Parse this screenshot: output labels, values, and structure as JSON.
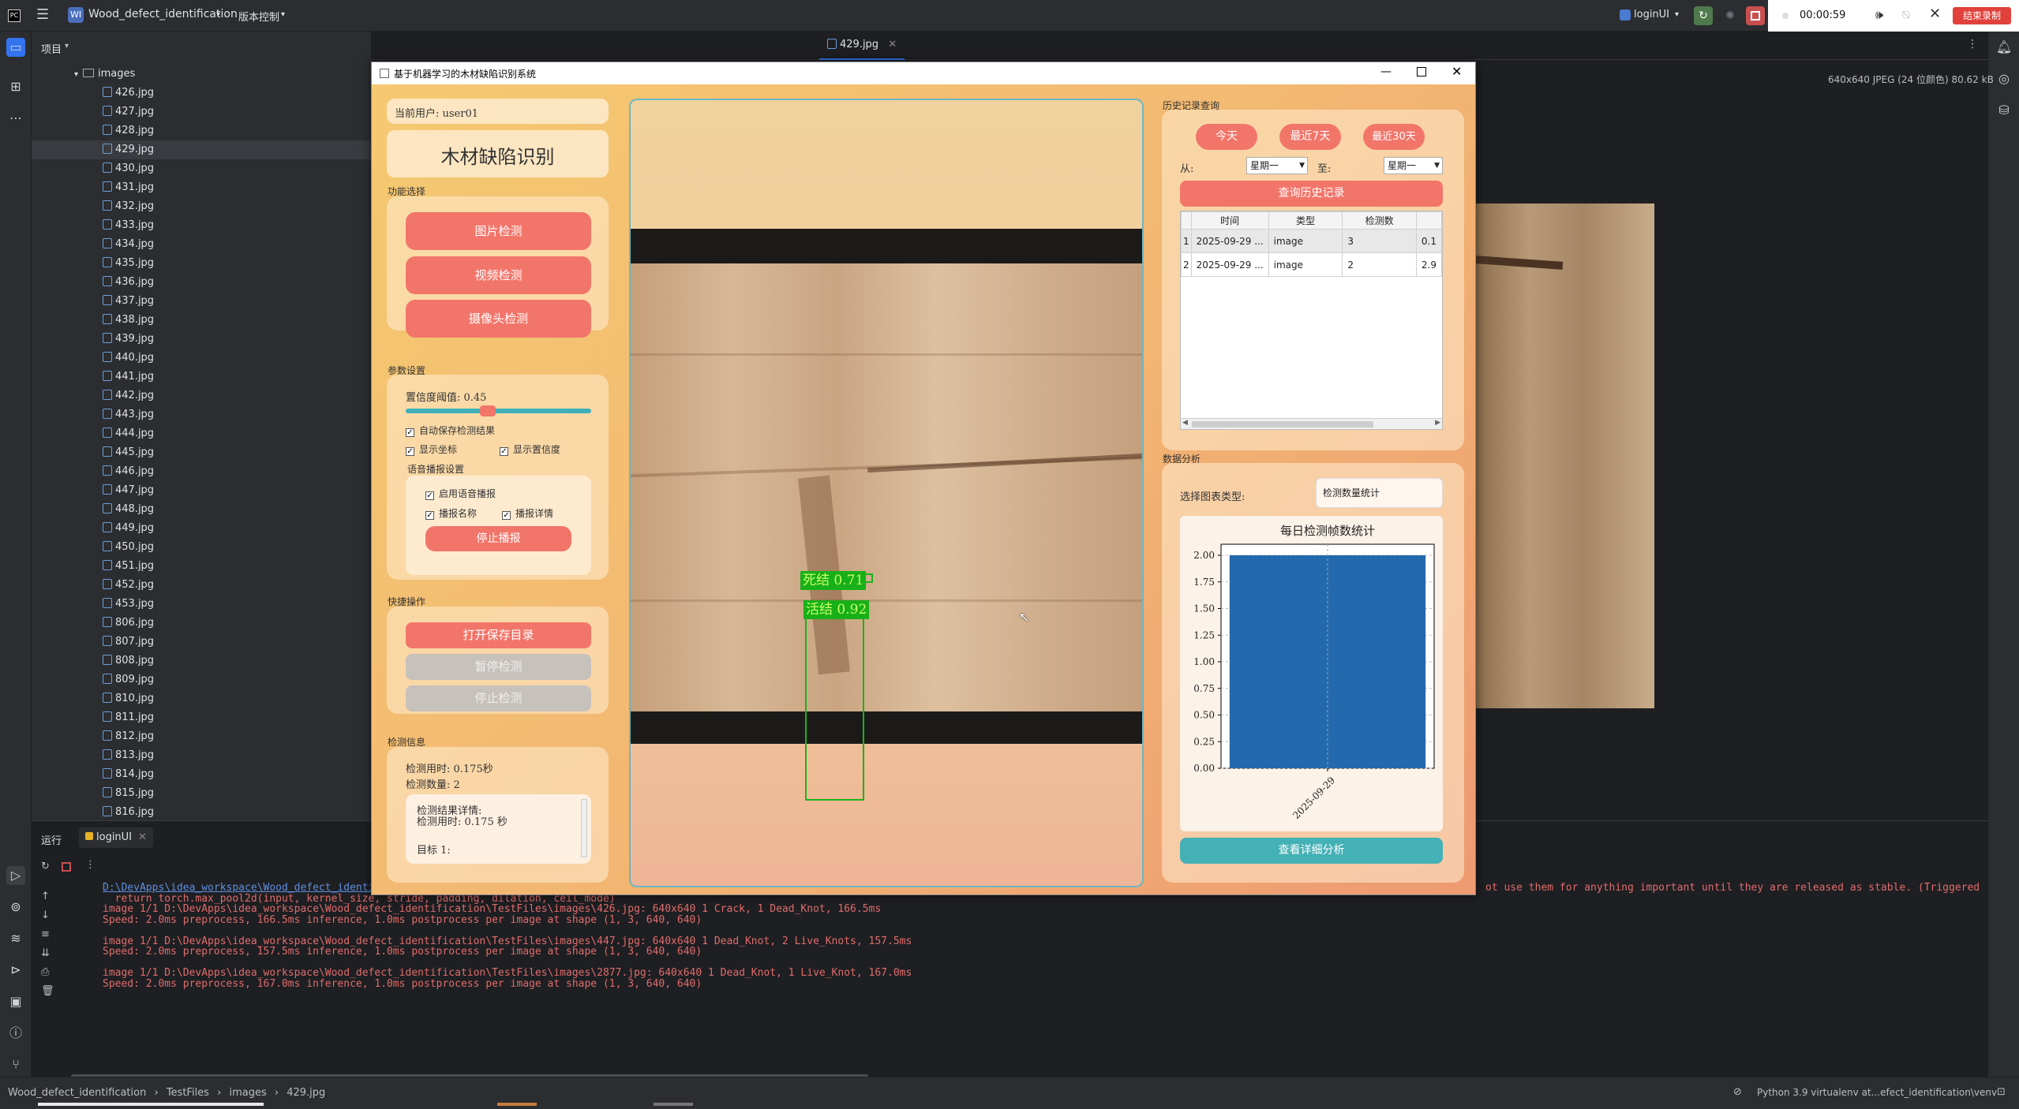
{
  "ide": {
    "project_name": "Wood_defect_identification",
    "project_badge": "WI",
    "vcs_label": "版本控制",
    "run_config": "loginUI",
    "rec_time": "00:00:59",
    "stop_rec": "结束录制",
    "project_tab": "项目",
    "tree_folder": "images",
    "files": [
      "426.jpg",
      "427.jpg",
      "428.jpg",
      "429.jpg",
      "430.jpg",
      "431.jpg",
      "432.jpg",
      "433.jpg",
      "434.jpg",
      "435.jpg",
      "436.jpg",
      "437.jpg",
      "438.jpg",
      "439.jpg",
      "440.jpg",
      "441.jpg",
      "442.jpg",
      "443.jpg",
      "444.jpg",
      "445.jpg",
      "446.jpg",
      "447.jpg",
      "448.jpg",
      "449.jpg",
      "450.jpg",
      "451.jpg",
      "452.jpg",
      "453.jpg",
      "806.jpg",
      "807.jpg",
      "808.jpg",
      "809.jpg",
      "810.jpg",
      "811.jpg",
      "812.jpg",
      "813.jpg",
      "814.jpg",
      "815.jpg",
      "816.jpg"
    ],
    "editor_tab": "429.jpg",
    "image_info": "640x640 JPEG (24 位颜色) 80.62 kB",
    "run_tab": "运行",
    "run_config_tab": "loginUI",
    "logs": [
      "D:\\DevApps\\idea_workspace\\Wood_defect_identific",
      "  return torch.max_pool2d(input, kernel_size, stride, padding, dilation, ceil_mode)",
      "image 1/1 D:\\DevApps\\idea_workspace\\Wood_defect_identification\\TestFiles\\images\\426.jpg: 640x640 1 Crack, 1 Dead_Knot, 166.5ms",
      "Speed: 2.0ms preprocess, 166.5ms inference, 1.0ms postprocess per image at shape (1, 3, 640, 640)",
      "",
      "image 1/1 D:\\DevApps\\idea_workspace\\Wood_defect_identification\\TestFiles\\images\\447.jpg: 640x640 1 Dead_Knot, 2 Live_Knots, 157.5ms",
      "Speed: 2.0ms preprocess, 157.5ms inference, 1.0ms postprocess per image at shape (1, 3, 640, 640)",
      "",
      "image 1/1 D:\\DevApps\\idea_workspace\\Wood_defect_identification\\TestFiles\\images\\2877.jpg: 640x640 1 Dead_Knot, 1 Live_Knot, 167.0ms",
      "Speed: 2.0ms preprocess, 167.0ms inference, 1.0ms postprocess per image at shape (1, 3, 640, 640)"
    ],
    "log_right": "ot use them for anything important until they are released as stable. (Triggered",
    "status": {
      "crumb1": "Wood_defect_identification",
      "crumb2": "TestFiles",
      "crumb3": "images",
      "crumb4": "429.jpg",
      "interpreter": "Python 3.9 virtualenv at...efect_identification\\venv"
    }
  },
  "app": {
    "window_title": "基于机器学习的木材缺陷识别系统",
    "current_user": "当前用户: user01",
    "heading": "木材缺陷识别",
    "func_section": "功能选择",
    "btn_image": "图片检测",
    "btn_video": "视频检测",
    "btn_camera": "摄像头检测",
    "param_section": "参数设置",
    "conf_label": "置信度阈值: 0.45",
    "conf_value": 0.45,
    "cb_autosave": "自动保存检测结果",
    "cb_coords": "显示坐标",
    "cb_conf": "显示置信度",
    "voice_section": "语音播报设置",
    "cb_voice": "启用语音播报",
    "cb_name": "播报名称",
    "cb_detail": "播报详情",
    "btn_stop_voice": "停止播报",
    "quick_section": "快捷操作",
    "btn_open_dir": "打开保存目录",
    "btn_pause": "暂停检测",
    "btn_stop": "停止检测",
    "info_section": "检测信息",
    "time_used": "检测用时: 0.175秒",
    "count": "检测数量: 2",
    "detail_title": "检测结果详情:",
    "detail_time": "检测用时: 0.175 秒",
    "detail_target": "目标 1:",
    "det1_label": "死结 0.71",
    "det2_label": "活结 0.92",
    "history_section": "历史记录查询",
    "btn_today": "今天",
    "btn_7days": "最近7天",
    "btn_30days": "最近30天",
    "from_label": "从:",
    "to_label": "至:",
    "from_value": "星期一",
    "to_value": "星期一",
    "btn_query": "查询历史记录",
    "table": {
      "headers": [
        "时间",
        "类型",
        "检测数"
      ],
      "rows": [
        {
          "idx": "1",
          "time": "2025-09-29 ...",
          "type": "image",
          "count": "3",
          "extra": "0.1"
        },
        {
          "idx": "2",
          "time": "2025-09-29 ...",
          "type": "image",
          "count": "2",
          "extra": "2.9"
        }
      ]
    },
    "analysis_section": "数据分析",
    "chart_type_label": "选择图表类型:",
    "chart_type_value": "检测数量统计",
    "btn_detail_analysis": "查看详细分析"
  },
  "chart_data": {
    "type": "bar",
    "title": "每日检测帧数统计",
    "categories": [
      "2025-09-29"
    ],
    "values": [
      2.0
    ],
    "ylim": [
      0,
      2.0
    ],
    "yticks": [
      "0.00",
      "0.25",
      "0.50",
      "0.75",
      "1.00",
      "1.25",
      "1.50",
      "1.75",
      "2.00"
    ],
    "grid": true,
    "bar_color": "#2369ad"
  }
}
